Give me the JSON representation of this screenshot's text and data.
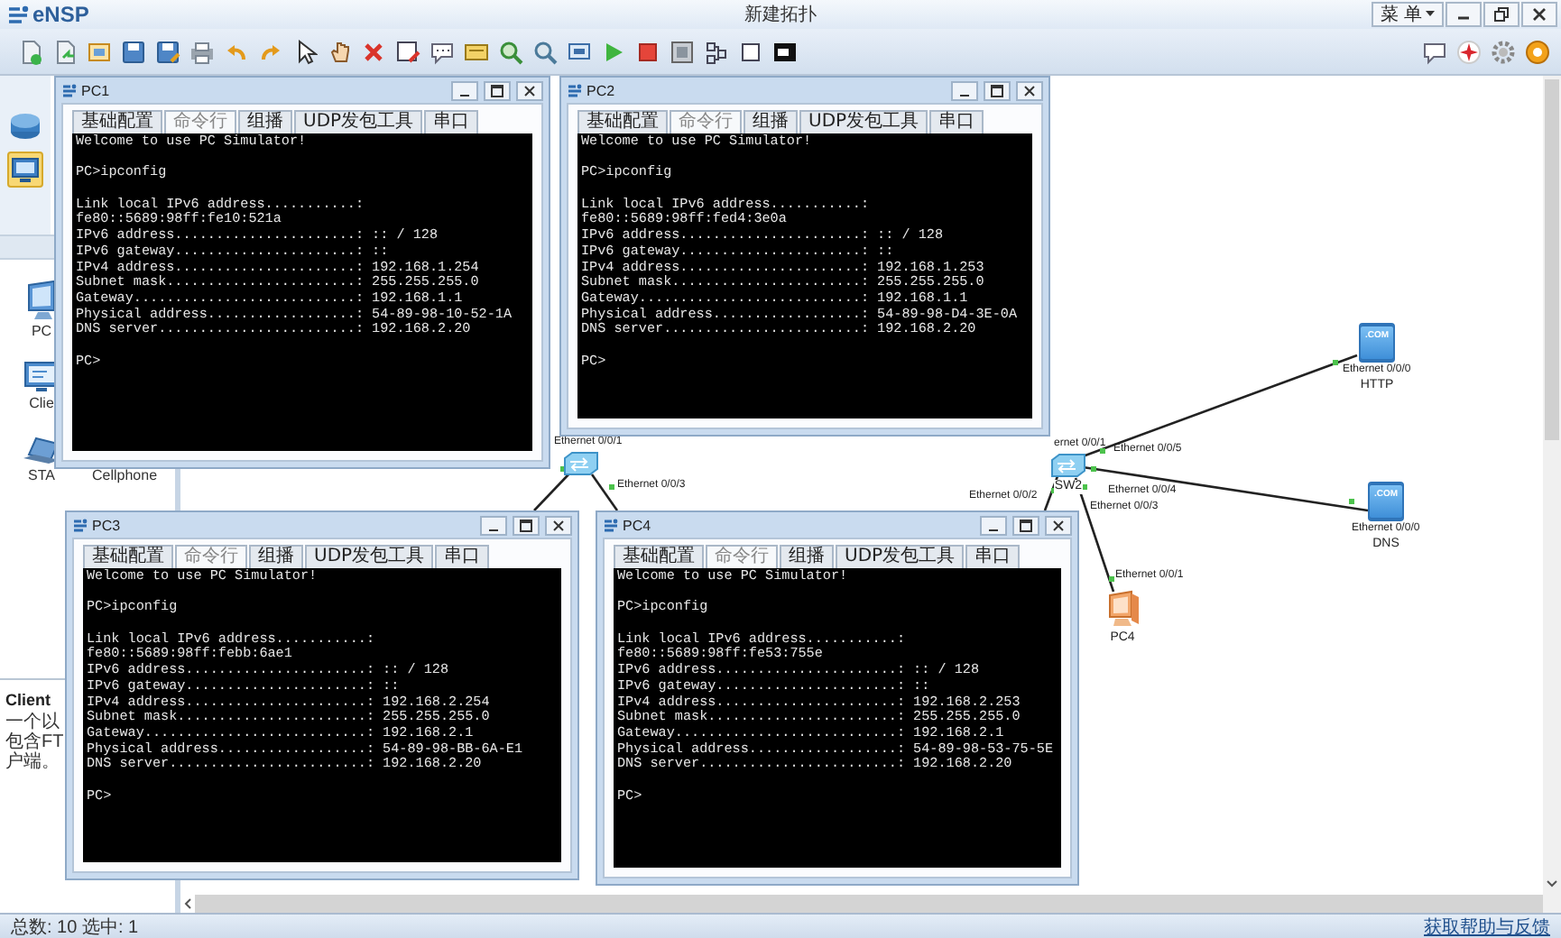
{
  "app": {
    "name": "eNSP",
    "title": "新建拓扑",
    "menu": "菜 单"
  },
  "sidebar": {
    "categories": [
      {
        "kind": "router",
        "selected": false
      },
      {
        "kind": "pc",
        "selected": true
      }
    ],
    "devices": [
      {
        "kind": "pc",
        "label": "PC"
      },
      {
        "kind": "client",
        "label": "Clie"
      },
      {
        "kind": "sta",
        "label": "STA"
      },
      {
        "kind": "cellphone",
        "label": "Cellphone"
      }
    ],
    "description": {
      "title": "Client",
      "lines": [
        "一个以",
        "包含FT",
        "户端。"
      ]
    }
  },
  "pc_windows": [
    {
      "title": "PC1",
      "tabs": [
        {
          "label": "基础配置",
          "selected": false
        },
        {
          "label": "命令行",
          "selected": true
        },
        {
          "label": "组播",
          "selected": false
        },
        {
          "label": "UDP发包工具",
          "selected": false
        },
        {
          "label": "串口",
          "selected": false
        }
      ],
      "output": [
        [
          "Welcome to use PC Simulator!"
        ],
        [
          "PC>ipconfig"
        ],
        [
          "Link local IPv6 address...........:",
          "fe80::5689:98ff:fe10:521a",
          "IPv6 address......................: :: / 128",
          "IPv6 gateway......................: ::",
          "IPv4 address......................: 192.168.1.254",
          "Subnet mask.......................: 255.255.255.0",
          "Gateway...........................: 192.168.1.1",
          "Physical address..................: 54-89-98-10-52-1A",
          "DNS server........................: 192.168.2.20"
        ],
        [
          "PC>"
        ]
      ]
    },
    {
      "title": "PC2",
      "tabs": [
        {
          "label": "基础配置",
          "selected": false
        },
        {
          "label": "命令行",
          "selected": true
        },
        {
          "label": "组播",
          "selected": false
        },
        {
          "label": "UDP发包工具",
          "selected": false
        },
        {
          "label": "串口",
          "selected": false
        }
      ],
      "output": [
        [
          "Welcome to use PC Simulator!"
        ],
        [
          "PC>ipconfig"
        ],
        [
          "Link local IPv6 address...........:",
          "fe80::5689:98ff:fed4:3e0a",
          "IPv6 address......................: :: / 128",
          "IPv6 gateway......................: ::",
          "IPv4 address......................: 192.168.1.253",
          "Subnet mask.......................: 255.255.255.0",
          "Gateway...........................: 192.168.1.1",
          "Physical address..................: 54-89-98-D4-3E-0A",
          "DNS server........................: 192.168.2.20"
        ],
        [
          "PC>"
        ]
      ]
    },
    {
      "title": "PC3",
      "tabs": [
        {
          "label": "基础配置",
          "selected": false
        },
        {
          "label": "命令行",
          "selected": true
        },
        {
          "label": "组播",
          "selected": false
        },
        {
          "label": "UDP发包工具",
          "selected": false
        },
        {
          "label": "串口",
          "selected": false
        }
      ],
      "output": [
        [
          "Welcome to use PC Simulator!"
        ],
        [
          "PC>ipconfig"
        ],
        [
          "Link local IPv6 address...........:",
          "fe80::5689:98ff:febb:6ae1",
          "IPv6 address......................: :: / 128",
          "IPv6 gateway......................: ::",
          "IPv4 address......................: 192.168.2.254",
          "Subnet mask.......................: 255.255.255.0",
          "Gateway...........................: 192.168.2.1",
          "Physical address..................: 54-89-98-BB-6A-E1",
          "DNS server........................: 192.168.2.20"
        ],
        [
          "PC>"
        ]
      ]
    },
    {
      "title": "PC4",
      "tabs": [
        {
          "label": "基础配置",
          "selected": false
        },
        {
          "label": "命令行",
          "selected": true
        },
        {
          "label": "组播",
          "selected": false
        },
        {
          "label": "UDP发包工具",
          "selected": false
        },
        {
          "label": "串口",
          "selected": false
        }
      ],
      "output": [
        [
          "Welcome to use PC Simulator!"
        ],
        [
          "PC>ipconfig"
        ],
        [
          "Link local IPv6 address...........:",
          "fe80::5689:98ff:fe53:755e",
          "IPv6 address......................: :: / 128",
          "IPv6 gateway......................: ::",
          "IPv4 address......................: 192.168.2.253",
          "Subnet mask.......................: 255.255.255.0",
          "Gateway...........................: 192.168.2.1",
          "Physical address..................: 54-89-98-53-75-5E",
          "DNS server........................: 192.168.2.20"
        ],
        [
          "PC>"
        ]
      ]
    }
  ],
  "topology": {
    "nodes": [
      {
        "kind": "switch"
      },
      {
        "kind": "switch",
        "label": "SW2"
      },
      {
        "kind": "server",
        "label": "HTTP",
        "badge": ".COM"
      },
      {
        "kind": "server",
        "label": "DNS",
        "badge": ".COM"
      },
      {
        "kind": "pc",
        "label": "PC4"
      }
    ],
    "port_labels": [
      "Ethernet 0/0/1",
      "Ethernet 0/0/3",
      "ernet 0/0/1",
      "Ethernet 0/0/5",
      "Ethernet 0/0/4",
      "Ethernet 0/0/2",
      "Ethernet 0/0/3",
      "Ethernet 0/0/0",
      "Ethernet 0/0/0",
      "Ethernet 0/0/1"
    ]
  },
  "status_bar": {
    "summary": "总数: 10 选中: 1",
    "help_link": "获取帮助与反馈"
  }
}
